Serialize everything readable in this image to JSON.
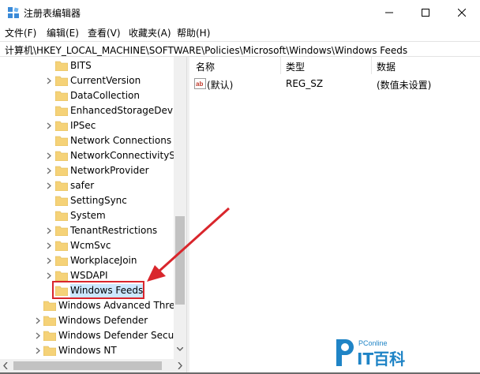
{
  "window": {
    "title": "注册表编辑器",
    "icon": "regedit-icon",
    "controls": [
      "minimize-icon",
      "maximize-icon",
      "close-icon"
    ]
  },
  "menu": {
    "file": "文件(F)",
    "edit": "编辑(E)",
    "view": "查看(V)",
    "favorites": "收藏夹(A)",
    "help": "帮助(H)"
  },
  "address": {
    "path": "计算机\\HKEY_LOCAL_MACHINE\\SOFTWARE\\Policies\\Microsoft\\Windows\\Windows Feeds"
  },
  "tree": {
    "items": [
      {
        "label": "BITS",
        "expandable": false
      },
      {
        "label": "CurrentVersion",
        "expandable": true
      },
      {
        "label": "DataCollection",
        "expandable": false
      },
      {
        "label": "EnhancedStorageDevice",
        "expandable": false
      },
      {
        "label": "IPSec",
        "expandable": true
      },
      {
        "label": "Network Connections",
        "expandable": false
      },
      {
        "label": "NetworkConnectivitySta",
        "expandable": true
      },
      {
        "label": "NetworkProvider",
        "expandable": true
      },
      {
        "label": "safer",
        "expandable": true
      },
      {
        "label": "SettingSync",
        "expandable": false
      },
      {
        "label": "System",
        "expandable": false
      },
      {
        "label": "TenantRestrictions",
        "expandable": true
      },
      {
        "label": "WcmSvc",
        "expandable": true
      },
      {
        "label": "WorkplaceJoin",
        "expandable": true
      },
      {
        "label": "WSDAPI",
        "expandable": true
      },
      {
        "label": "Windows Feeds",
        "expandable": false,
        "selected": true
      },
      {
        "label": "Windows Advanced Threa",
        "expandable": false
      },
      {
        "label": "Windows Defender",
        "expandable": true
      },
      {
        "label": "Windows Defender Securit",
        "expandable": true
      },
      {
        "label": "Windows NT",
        "expandable": true
      }
    ]
  },
  "list": {
    "columns": [
      "名称",
      "类型",
      "数据"
    ],
    "rows": [
      {
        "name": "(默认)",
        "type": "REG_SZ",
        "data": "(数值未设置)",
        "icon": "string-value-icon"
      }
    ]
  },
  "annotation": {
    "color": "#d9262c"
  },
  "watermark": {
    "brand": "PConline",
    "text": "IT百科"
  },
  "colors": {
    "folder": "#f5d278",
    "selection": "#cce8ff",
    "annotation": "#d9262c",
    "watermark": "#1f84c6"
  }
}
